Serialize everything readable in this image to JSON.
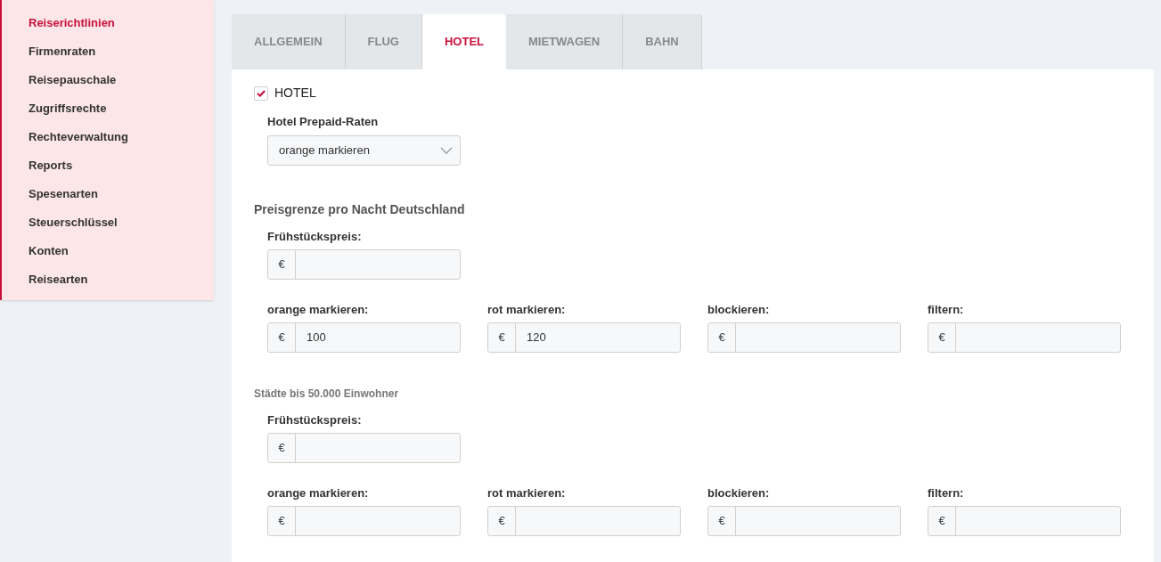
{
  "sidebar": {
    "items": [
      {
        "label": "Reiserichtlinien",
        "selected": true
      },
      {
        "label": "Firmenraten",
        "selected": false
      },
      {
        "label": "Reisepauschale",
        "selected": false
      },
      {
        "label": "Zugriffsrechte",
        "selected": false
      },
      {
        "label": "Rechteverwaltung",
        "selected": false
      },
      {
        "label": "Reports",
        "selected": false
      },
      {
        "label": "Spesenarten",
        "selected": false
      },
      {
        "label": "Steuerschlüssel",
        "selected": false
      },
      {
        "label": "Konten",
        "selected": false
      },
      {
        "label": "Reisearten",
        "selected": false
      }
    ]
  },
  "tabs": [
    {
      "label": "ALLGEMEIN",
      "selected": false
    },
    {
      "label": "FLUG",
      "selected": false
    },
    {
      "label": "HOTEL",
      "selected": true
    },
    {
      "label": "MIETWAGEN",
      "selected": false
    },
    {
      "label": "BAHN",
      "selected": false
    }
  ],
  "hotel_checkbox": {
    "label": "HOTEL",
    "checked": true
  },
  "prepaid": {
    "label": "Hotel Prepaid-Raten",
    "value": "orange markieren"
  },
  "sections": [
    {
      "title": "Preisgrenze pro Nacht Deutschland",
      "kind": "main",
      "breakfast": {
        "label": "Frühstückspreis:",
        "prefix": "€"
      },
      "fields": [
        {
          "label": "orange markieren:",
          "prefix": "€",
          "value": "100"
        },
        {
          "label": "rot markieren:",
          "prefix": "€",
          "value": "120"
        },
        {
          "label": "blockieren:",
          "prefix": "€"
        },
        {
          "label": "filtern:",
          "prefix": "€"
        }
      ]
    },
    {
      "title": "Städte bis 50.000 Einwohner",
      "kind": "sub",
      "breakfast": {
        "label": "Frühstückspreis:",
        "prefix": "€"
      },
      "fields": [
        {
          "label": "orange markieren:",
          "prefix": "€"
        },
        {
          "label": "rot markieren:",
          "prefix": "€"
        },
        {
          "label": "blockieren:",
          "prefix": "€"
        },
        {
          "label": "filtern:",
          "prefix": "€"
        }
      ]
    }
  ]
}
